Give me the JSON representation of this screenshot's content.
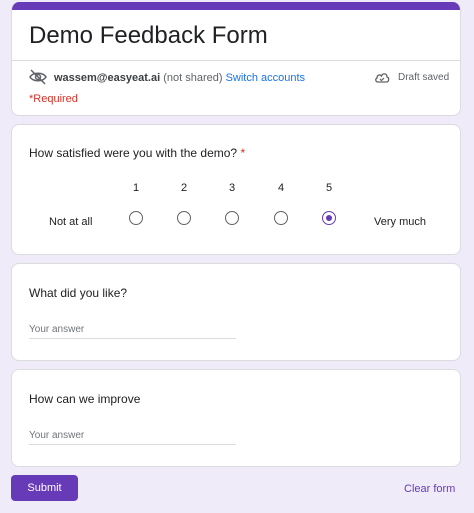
{
  "header": {
    "title": "Demo Feedback Form",
    "email": "wassem@easyeat.ai",
    "not_shared": "(not shared)",
    "switch_accounts": "Switch accounts",
    "draft_status": "Draft saved",
    "required_note": "*Required",
    "icons": {
      "account": "eye-slash-icon",
      "draft": "cloud-check-icon"
    }
  },
  "question1": {
    "title": "How satisfied were you with the demo?",
    "required_marker": "*",
    "scale": [
      "1",
      "2",
      "3",
      "4",
      "5"
    ],
    "low_label": "Not at all",
    "high_label": "Very much",
    "selected": "5"
  },
  "question2": {
    "title": "What did you like?",
    "placeholder": "Your answer",
    "value": ""
  },
  "question3": {
    "title": "How can we improve",
    "placeholder": "Your answer",
    "value": ""
  },
  "footer": {
    "submit_label": "Submit",
    "clear_label": "Clear form"
  },
  "colors": {
    "accent": "#673ab7",
    "background": "#f0ebf8",
    "required": "#d93025",
    "link": "#1a73e8"
  }
}
